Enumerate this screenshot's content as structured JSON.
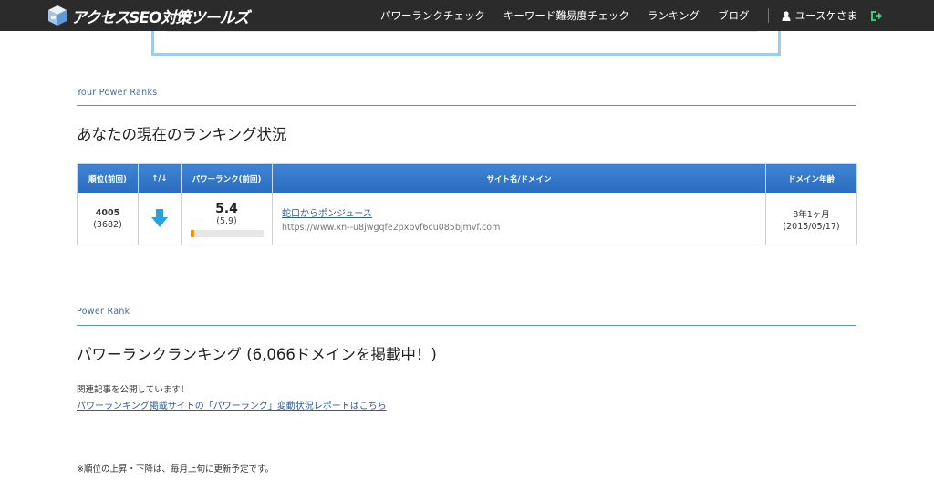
{
  "header": {
    "logo_text": "アクセスSEO対策ツールズ",
    "nav": [
      {
        "label": "パワーランクチェック"
      },
      {
        "label": "キーワード難易度チェック"
      },
      {
        "label": "ランキング"
      },
      {
        "label": "ブログ"
      }
    ],
    "user_label": "ユースケさま"
  },
  "your_ranks": {
    "eyebrow": "Your Power Ranks",
    "title": "あなたの現在のランキング状況",
    "columns": [
      "順位(前回)",
      "↑/↓",
      "パワーランク(前回)",
      "サイト名/ドメイン",
      "ドメイン年齢"
    ],
    "row": {
      "rank": "4005",
      "rank_prev": "(3682)",
      "trend": "down",
      "power": "5.4",
      "power_prev": "(5.9)",
      "power_fill_fraction": 0.05,
      "site_name": "蛇口からポンジュース",
      "site_domain": "https://www.xn--u8jwgqfe2pxbvf6cu085bjmvf.com",
      "age": "8年1ヶ月",
      "age_date": "(2015/05/17)"
    }
  },
  "power_rank": {
    "eyebrow": "Power Rank",
    "title": "パワーランクランキング (6,066ドメインを掲載中！)",
    "intro": "関連記事を公開しています！",
    "link": "パワーランキング掲載サイトの「パワーランク」変動状況レポートはこちら",
    "note": "※順位の上昇・下降は、毎月上旬に更新予定です。"
  },
  "colors": {
    "header_bg": "#2b2b2b",
    "table_header": "#3478c9",
    "arrow_down": "#2aa3dc",
    "power_bar": "#f39800",
    "logout_icon": "#3cc87a"
  }
}
